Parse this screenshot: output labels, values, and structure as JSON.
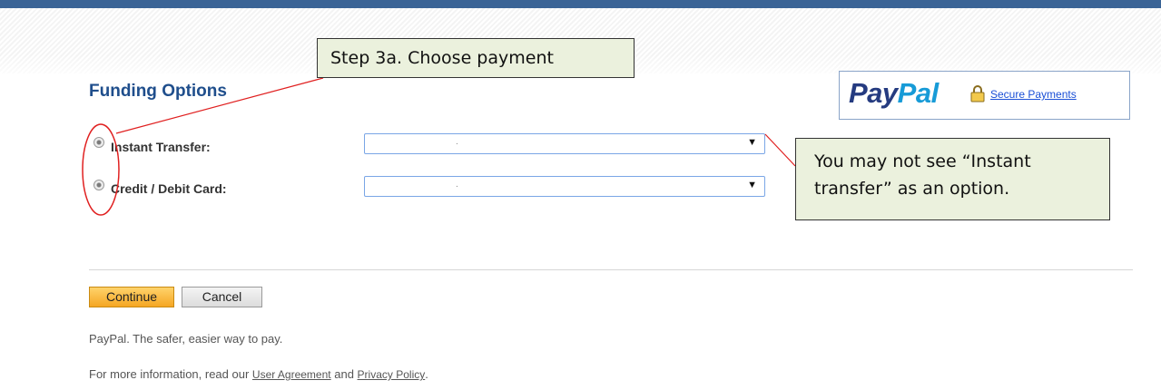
{
  "header": {
    "accent_color": "#3b6496"
  },
  "section_title": "Funding Options",
  "paypal": {
    "logo_part1": "Pay",
    "logo_part2": "Pal",
    "secure_link": "Secure Payments",
    "lock_icon": "lock-icon"
  },
  "funding_options": [
    {
      "label": "Instant Transfer:",
      "selected_value": "."
    },
    {
      "label": "Credit / Debit Card:",
      "selected_value": "."
    }
  ],
  "callouts": {
    "step": "Step 3a. Choose payment",
    "note": "You may not see “Instant transfer” as an option."
  },
  "buttons": {
    "continue": "Continue",
    "cancel": "Cancel"
  },
  "footer": {
    "tagline": "PayPal. The safer, easier way to pay.",
    "more_info_prefix": "For more information, read our ",
    "user_agreement": "User Agreement",
    "and": " and ",
    "privacy_policy": "Privacy Policy",
    "suffix": "."
  },
  "colors": {
    "continue_button": "#f5a623",
    "callout_bg": "#ebf1dd",
    "annotation_red": "#e02020"
  }
}
